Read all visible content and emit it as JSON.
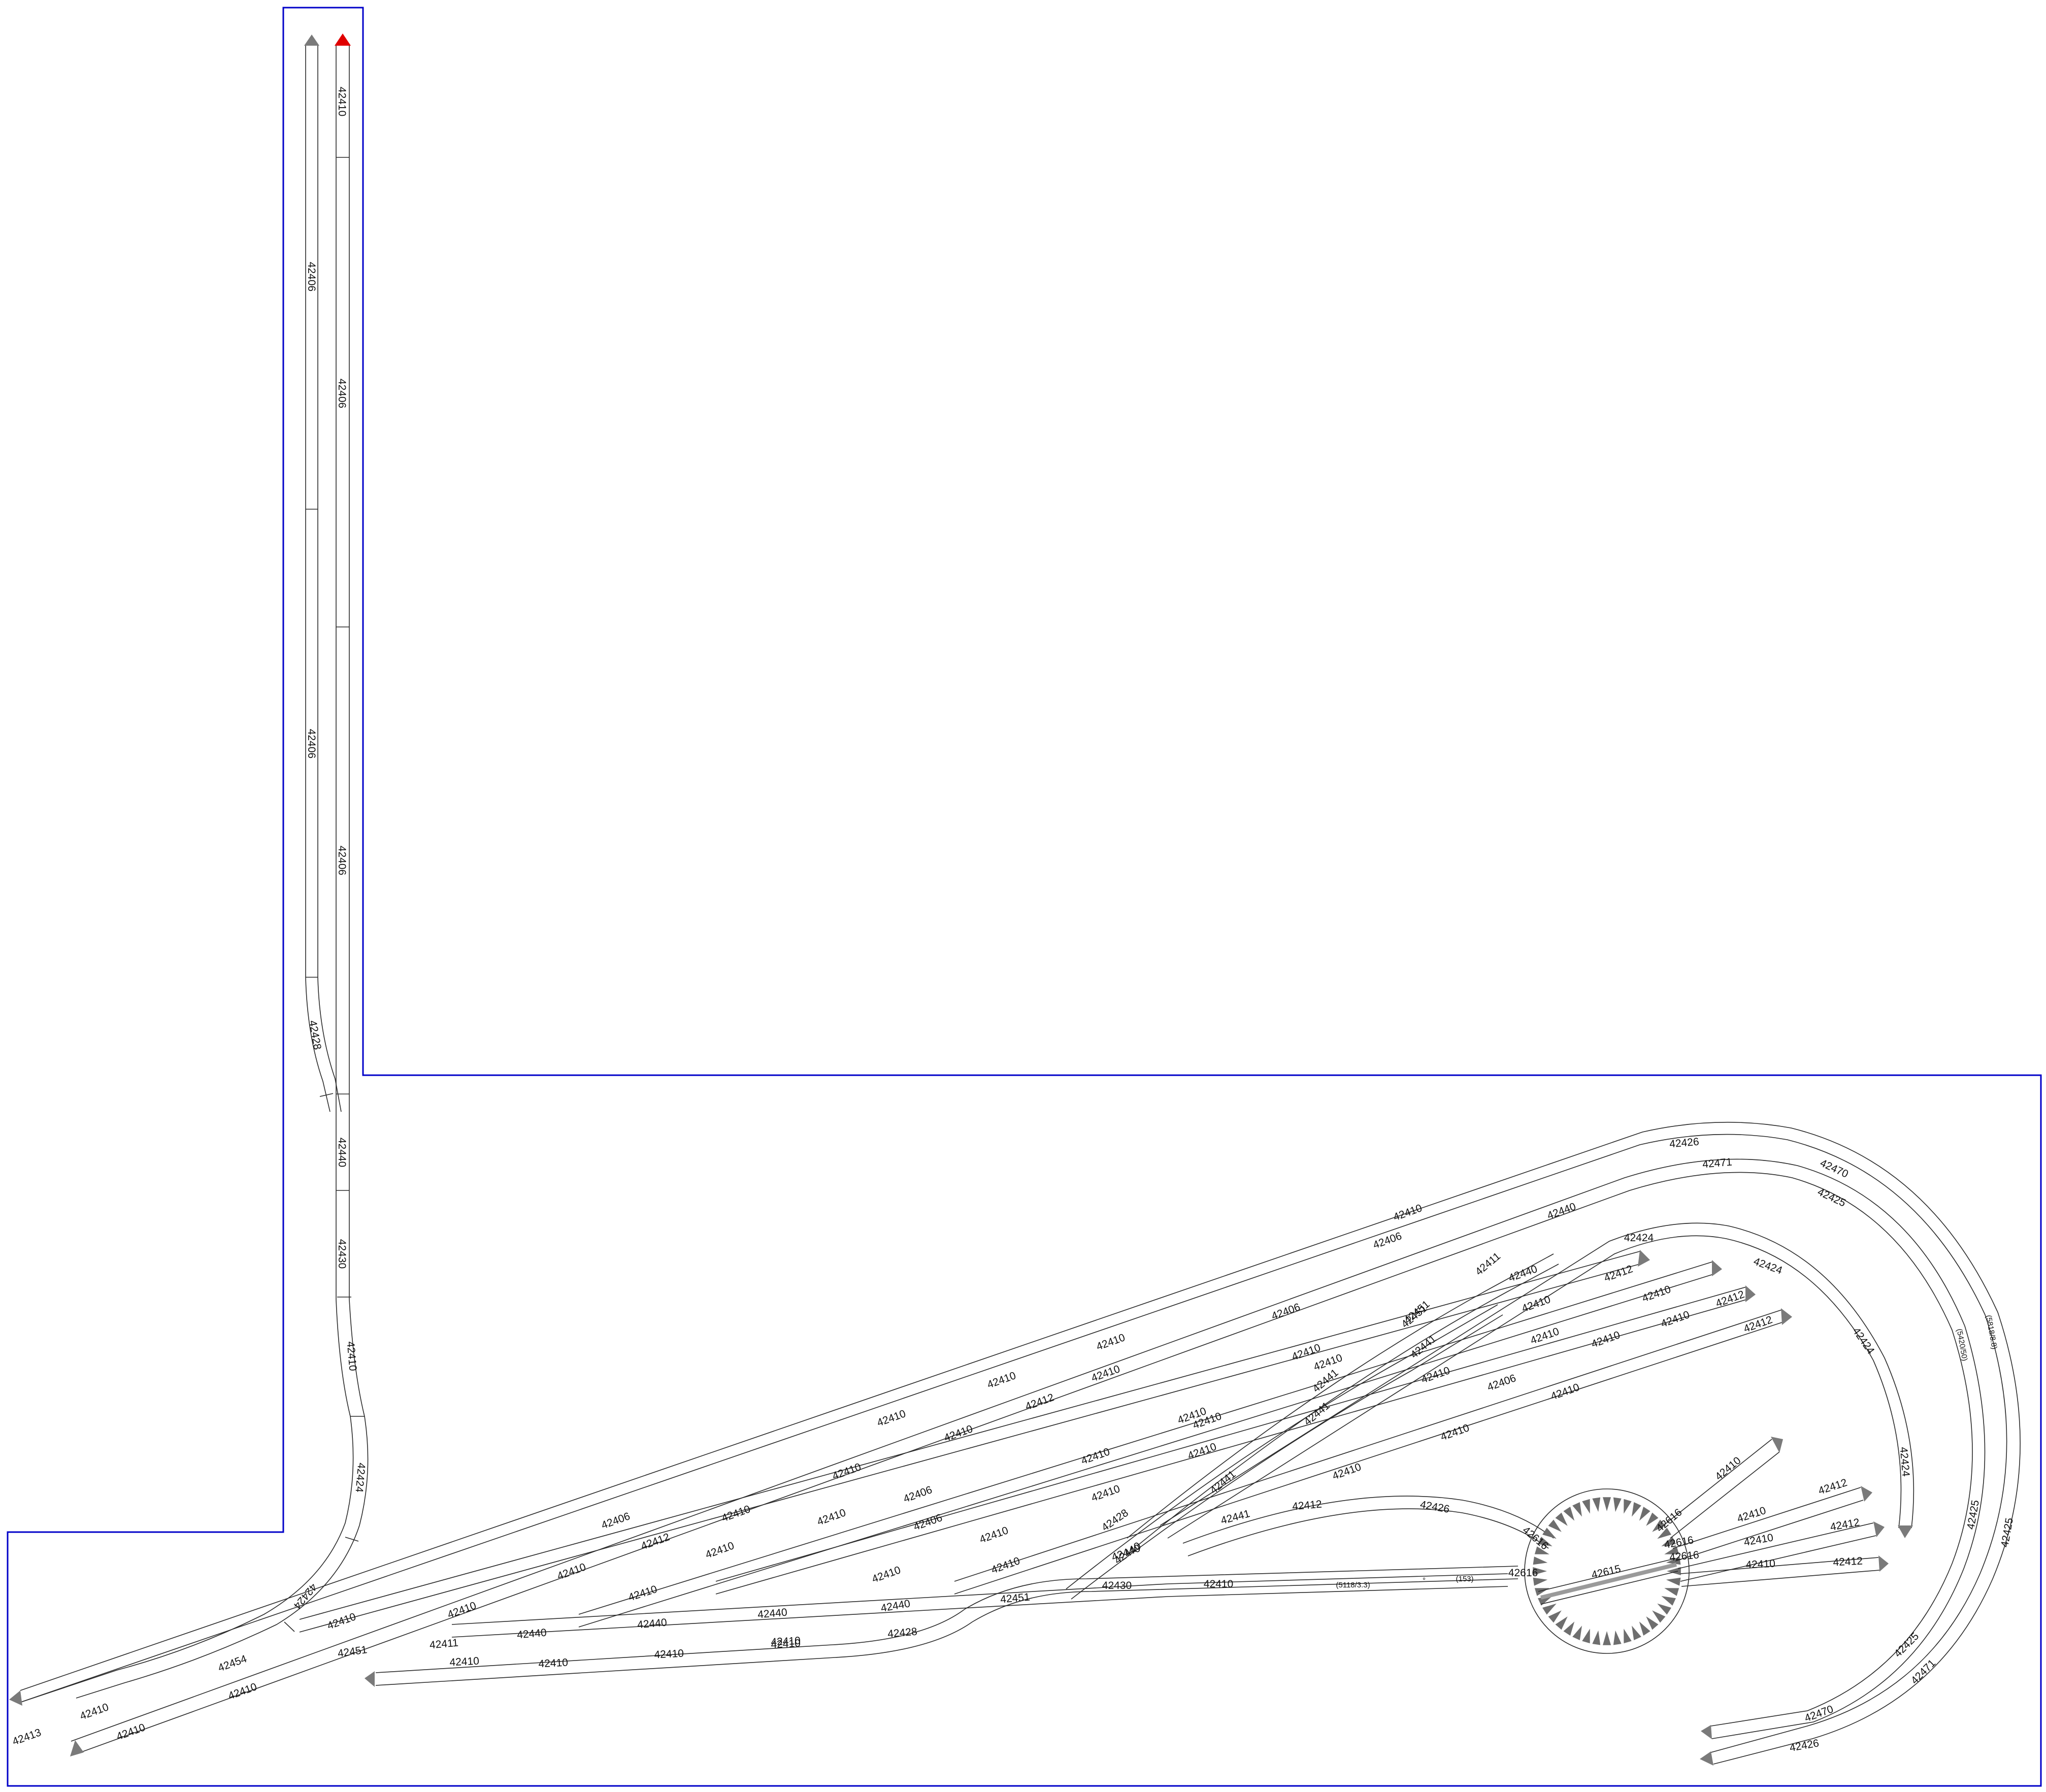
{
  "layout": {
    "colors": {
      "board_edge": "#0000c8",
      "track": "#2b2b2b",
      "track_end": "#7a7a7a",
      "active_end": "#e00000",
      "turntable_teeth": "#6e6e6e",
      "background": "#ffffff"
    },
    "vertical_branch": {
      "left_track": [
        "42406",
        "42406",
        "42428"
      ],
      "right_track": [
        "42410",
        "42406",
        "42406",
        "42440",
        "42430",
        "42410",
        "42424",
        "42424"
      ]
    },
    "main_labels": {
      "l01": "42406",
      "l02": "42406",
      "l03": "42410",
      "l04": "42410",
      "l05": "42410",
      "l06": "42406",
      "l07": "42410",
      "l08": "42410",
      "l09": "42454",
      "l10": "42410",
      "l11": "42413",
      "l12": "42410",
      "l13": "42410",
      "l14": "42412",
      "l15": "42410",
      "l16": "42410",
      "l17": "42410",
      "l18": "42412",
      "l19": "42410",
      "l20": "42410",
      "l21": "42440",
      "l22": "42451",
      "l23": "42410",
      "l24": "42410",
      "l25": "42410",
      "l26": "42411",
      "l27": "42451",
      "l28": "42440",
      "l29": "42440",
      "l30": "42410",
      "l31": "42406",
      "l32": "42406",
      "l33": "42410",
      "l34": "42410",
      "l35": "42410",
      "l36": "42410",
      "l37": "42440",
      "l38": "42440",
      "l39": "42410",
      "l40": "42410",
      "l41": "42410",
      "l42": "42410",
      "l43": "42410",
      "l44": "42428",
      "l45": "42440",
      "l46": "42451",
      "l47": "42441",
      "l48": "42441",
      "l49": "42441",
      "l50": "42441",
      "l51": "42441",
      "l52": "42451",
      "l53": "42411",
      "l54": "42440",
      "l55": "42440",
      "l56": "42410",
      "l57": "42410",
      "l58": "42410",
      "l59": "42410",
      "l60": "42406",
      "l61": "42410",
      "l62": "42410",
      "l63": "42410",
      "l64": "42410",
      "l65": "42410",
      "l66": "42412",
      "l67": "42410",
      "l68": "42412",
      "l69": "42412",
      "l70": "42426",
      "l71": "42471",
      "l72": "42470",
      "l73": "42425",
      "l74": "42424",
      "l75": "42424",
      "l76": "42424",
      "l77": "42424",
      "l78": "42412",
      "l79": "42426",
      "l80": "42430",
      "l81": "42410",
      "l82": "42616",
      "l83": "42616",
      "l84": "42616",
      "l85": "42616",
      "l86": "42616",
      "l87": "42615",
      "l88": "42410",
      "l89": "42410",
      "l90": "42410",
      "l91": "42410",
      "l92": "42412",
      "l93": "42412",
      "l94": "42412",
      "l95": "42425",
      "l96": "42425",
      "l97": "42425",
      "l98": "42470",
      "l99": "42471",
      "l100": "42426",
      "l101": "42428",
      "l102": "42410",
      "l103": "42410",
      "l104": "42410",
      "l105": "42410",
      "l106": "42410"
    },
    "small_labels": {
      "s1": "(5118/3.3)",
      "s2": "(153)",
      "s3": "(5420/50)",
      "s4": "(5818/8.8)",
      "s5": "°"
    }
  }
}
